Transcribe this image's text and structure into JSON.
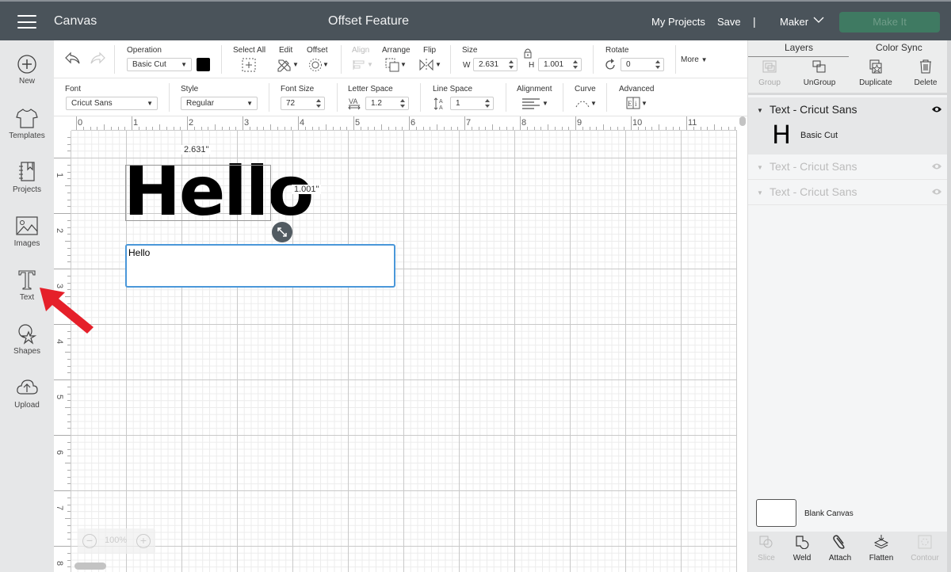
{
  "header": {
    "app_name": "Canvas",
    "document_title": "Offset Feature",
    "my_projects": "My Projects",
    "save": "Save",
    "separator": "|",
    "machine": "Maker",
    "make_it": "Make It"
  },
  "sidebar": {
    "items": [
      {
        "label": "New",
        "icon": "plus-circle-icon"
      },
      {
        "label": "Templates",
        "icon": "tshirt-icon"
      },
      {
        "label": "Projects",
        "icon": "notebook-icon"
      },
      {
        "label": "Images",
        "icon": "image-icon"
      },
      {
        "label": "Text",
        "icon": "text-t-icon"
      },
      {
        "label": "Shapes",
        "icon": "shapes-icon"
      },
      {
        "label": "Upload",
        "icon": "cloud-upload-icon"
      }
    ]
  },
  "toolbar": {
    "operation_label": "Operation",
    "operation_value": "Basic Cut",
    "operation_color": "#000000",
    "select_all": "Select All",
    "edit": "Edit",
    "offset": "Offset",
    "align": "Align",
    "arrange": "Arrange",
    "flip": "Flip",
    "size_label": "Size",
    "width_letter": "W",
    "width_value": "2.631",
    "height_letter": "H",
    "height_value": "1.001",
    "rotate_label": "Rotate",
    "rotate_value": "0",
    "more": "More"
  },
  "text_toolbar": {
    "font_label": "Font",
    "font_value": "Cricut Sans",
    "style_label": "Style",
    "style_value": "Regular",
    "font_size_label": "Font Size",
    "font_size_value": "72",
    "letter_space_label": "Letter Space",
    "letter_space_value": "1.2",
    "line_space_label": "Line Space",
    "line_space_value": "1",
    "alignment_label": "Alignment",
    "curve_label": "Curve",
    "advanced_label": "Advanced"
  },
  "canvas": {
    "ruler_x": [
      "0",
      "1",
      "2",
      "3",
      "4",
      "5",
      "6",
      "7",
      "8",
      "9",
      "10",
      "11"
    ],
    "ruler_y": [
      "1",
      "2",
      "3",
      "4",
      "5",
      "6",
      "7",
      "8"
    ],
    "width_dim": "2.631\"",
    "height_dim": "1.001\"",
    "text_object": "Hello",
    "text_input_value": "Hello",
    "zoom_level": "100%"
  },
  "panel": {
    "tabs": [
      "Layers",
      "Color Sync"
    ],
    "tools": [
      {
        "label": "Group",
        "enabled": false
      },
      {
        "label": "UnGroup",
        "enabled": true
      },
      {
        "label": "Duplicate",
        "enabled": true
      },
      {
        "label": "Delete",
        "enabled": true
      }
    ],
    "layers": [
      {
        "title": "Text - Cricut Sans",
        "thumb": "H",
        "operation": "Basic Cut",
        "active": true
      },
      {
        "title": "Text - Cricut Sans",
        "active": false
      },
      {
        "title": "Text - Cricut Sans",
        "active": false
      }
    ],
    "blank_canvas": "Blank Canvas",
    "bottom_tools": [
      {
        "label": "Slice",
        "enabled": false
      },
      {
        "label": "Weld",
        "enabled": true
      },
      {
        "label": "Attach",
        "enabled": true
      },
      {
        "label": "Flatten",
        "enabled": true
      },
      {
        "label": "Contour",
        "enabled": false
      }
    ]
  },
  "colors": {
    "header_bg": "#4a535a",
    "make_it_bg": "#3f7a62",
    "selection_blue": "#4a97d9",
    "annotation_arrow": "#e5202a"
  }
}
